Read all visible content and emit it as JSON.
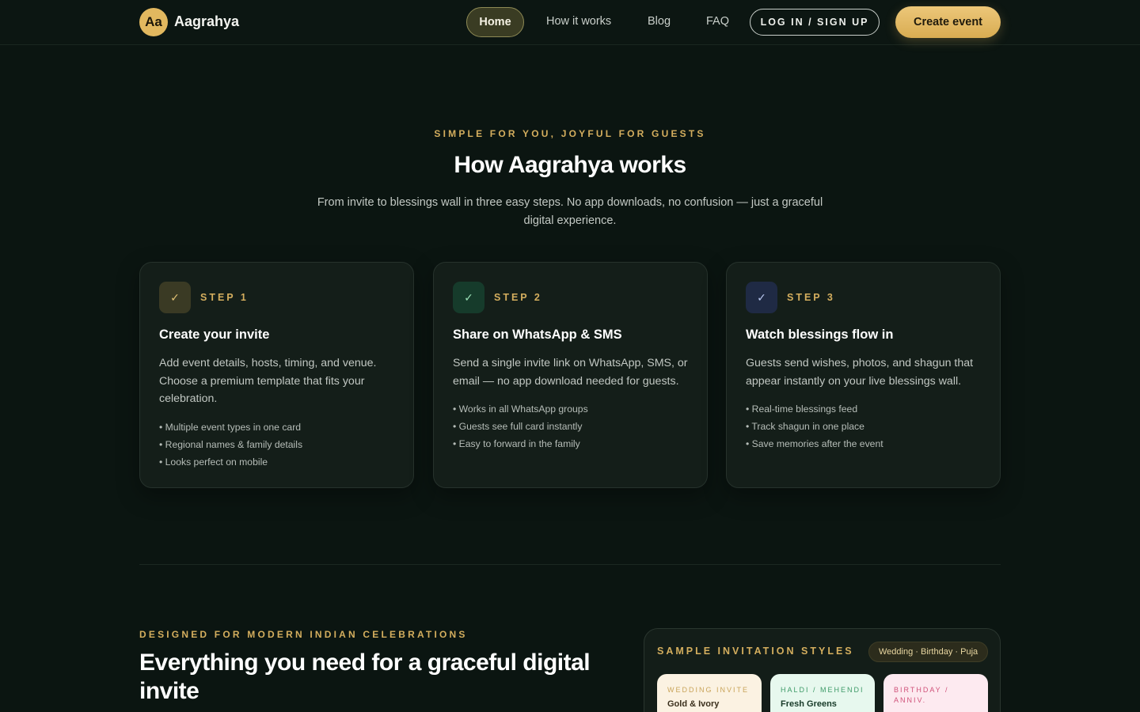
{
  "brand": {
    "logo_mark": "Aa",
    "name": "Aagrahya",
    "accent": "#e2b85f"
  },
  "nav": {
    "home": "Home",
    "how_it_works": "How it works",
    "blog": "Blog",
    "faq": "FAQ",
    "login": "LOG IN / SIGN UP",
    "create": "Create event"
  },
  "hero": {
    "eyebrow": "SIMPLE FOR YOU, JOYFUL FOR GUESTS",
    "title": "How Aagrahya works",
    "subtitle": "From invite to blessings wall in three easy steps. No app downloads, no confusion — just a graceful digital experience."
  },
  "steps": [
    {
      "icon": "check-icon",
      "label": "STEP 1",
      "title": "Create your invite",
      "desc": "Add event details, hosts, timing, and venue. Choose a premium template that fits your celebration.",
      "bullets": [
        "• Multiple event types in one card",
        "• Regional names & family details",
        "• Looks perfect on mobile"
      ]
    },
    {
      "icon": "check-icon",
      "label": "STEP 2",
      "title": "Share on WhatsApp & SMS",
      "desc": "Send a single invite link on WhatsApp, SMS, or email — no app download needed for guests.",
      "bullets": [
        "• Works in all WhatsApp groups",
        "• Guests see full card instantly",
        "• Easy to forward in the family"
      ]
    },
    {
      "icon": "check-icon",
      "label": "STEP 3",
      "title": "Watch blessings flow in",
      "desc": "Guests send wishes, photos, and shagun that appear instantly on your live blessings wall.",
      "bullets": [
        "• Real-time blessings feed",
        "• Track shagun in one place",
        "• Save memories after the event"
      ]
    }
  ],
  "features": {
    "eyebrow": "DESIGNED FOR MODERN INDIAN CELEBRATIONS",
    "title": "Everything you need for a graceful digital invite"
  },
  "samples": {
    "title": "SAMPLE INVITATION STYLES",
    "pill": "Wedding · Birthday · Puja",
    "cards": [
      {
        "eyebrow": "WEDDING INVITE",
        "name": "Gold & Ivory"
      },
      {
        "eyebrow": "HALDI / MEHENDI",
        "name": "Fresh Greens"
      },
      {
        "eyebrow": "BIRTHDAY / ANNIV.",
        "name": ""
      }
    ]
  }
}
